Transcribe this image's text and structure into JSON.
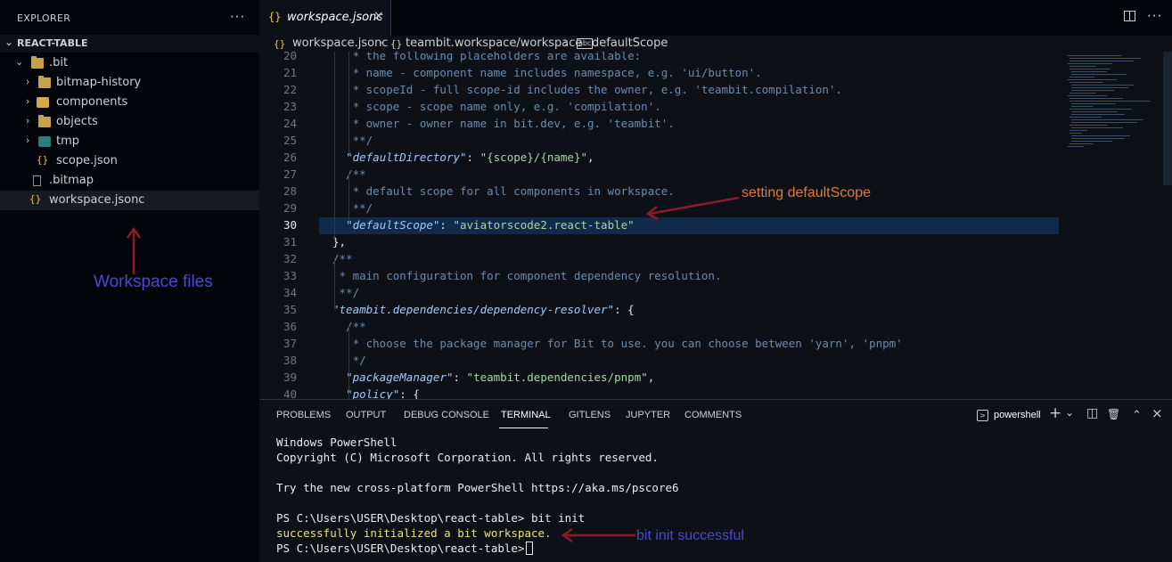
{
  "explorer": {
    "title": "EXPLORER",
    "more": "···",
    "section": "REACT-TABLE",
    "items": [
      {
        "label": ".bit",
        "chev": "⌄"
      },
      {
        "label": "bitmap-history",
        "chev": "›"
      },
      {
        "label": "components",
        "chev": "›"
      },
      {
        "label": "objects",
        "chev": "›"
      },
      {
        "label": "tmp",
        "chev": "›"
      },
      {
        "label": "scope.json",
        "icon": "{}"
      },
      {
        "label": ".bitmap"
      },
      {
        "label": "workspace.jsonc",
        "icon": "{}"
      }
    ]
  },
  "annotations": {
    "workspace_files": "Workspace files",
    "setting_scope": "setting defaultScope",
    "bit_init": "bit init successful",
    "colors": {
      "red_arrow": "#8b1a2b",
      "orange": "#e07b39",
      "blue": "#4a4ad0"
    }
  },
  "tab": {
    "icon": "{}",
    "label": "workspace.jsonc",
    "close": "×",
    "more": "···"
  },
  "breadcrumb": {
    "file_icon": "{}",
    "file": "workspace.jsonc",
    "sep": "›",
    "obj_icon": "{}",
    "obj": "teambit.workspace/workspace",
    "prop_icon": "abc",
    "prop": "defaultScope"
  },
  "editor": {
    "lines": [
      {
        "n": "20",
        "tokens": [
          {
            "t": "   * the following placeholders are available:",
            "c": "comment"
          }
        ]
      },
      {
        "n": "21",
        "tokens": [
          {
            "t": "   * name - component name includes namespace, e.g. 'ui/button'.",
            "c": "comment"
          }
        ]
      },
      {
        "n": "22",
        "tokens": [
          {
            "t": "   * scopeId - full scope-id includes the owner, e.g. 'teambit.compilation'.",
            "c": "comment"
          }
        ]
      },
      {
        "n": "23",
        "tokens": [
          {
            "t": "   * scope - scope name only, e.g. 'compilation'.",
            "c": "comment"
          }
        ]
      },
      {
        "n": "24",
        "tokens": [
          {
            "t": "   * owner - owner name in bit.dev, e.g. 'teambit'.",
            "c": "comment"
          }
        ]
      },
      {
        "n": "25",
        "tokens": [
          {
            "t": "   **/",
            "c": "comment"
          }
        ]
      },
      {
        "n": "26",
        "tokens": [
          {
            "t": "  ",
            "c": "punct"
          },
          {
            "t": "\"defaultDirectory\"",
            "c": "key"
          },
          {
            "t": ": ",
            "c": "punct"
          },
          {
            "t": "\"{scope}/{name}\"",
            "c": "str"
          },
          {
            "t": ",",
            "c": "punct"
          }
        ]
      },
      {
        "n": "27",
        "tokens": [
          {
            "t": "  /**",
            "c": "comment"
          }
        ]
      },
      {
        "n": "28",
        "tokens": [
          {
            "t": "   * default scope for all components in workspace.",
            "c": "comment"
          }
        ]
      },
      {
        "n": "29",
        "tokens": [
          {
            "t": "   **/",
            "c": "comment"
          }
        ]
      },
      {
        "n": "30",
        "tokens": [
          {
            "t": "  ",
            "c": "punct"
          },
          {
            "t": "\"defaultScope\"",
            "c": "key"
          },
          {
            "t": ": ",
            "c": "punct"
          },
          {
            "t": "\"aviatorscode2.react-table\"",
            "c": "str"
          }
        ]
      },
      {
        "n": "31",
        "tokens": [
          {
            "t": "},",
            "c": "punct"
          }
        ]
      },
      {
        "n": "32",
        "tokens": [
          {
            "t": "/**",
            "c": "comment"
          }
        ]
      },
      {
        "n": "33",
        "tokens": [
          {
            "t": " * main configuration for component dependency resolution.",
            "c": "comment"
          }
        ]
      },
      {
        "n": "34",
        "tokens": [
          {
            "t": " **/",
            "c": "comment"
          }
        ]
      },
      {
        "n": "35",
        "tokens": [
          {
            "t": "\"teambit.dependencies/dependency-resolver\"",
            "c": "key"
          },
          {
            "t": ": {",
            "c": "punct"
          }
        ]
      },
      {
        "n": "36",
        "tokens": [
          {
            "t": "  /**",
            "c": "comment"
          }
        ]
      },
      {
        "n": "37",
        "tokens": [
          {
            "t": "   * choose the package manager for Bit to use. you can choose between 'yarn', 'pnpm'",
            "c": "comment"
          }
        ]
      },
      {
        "n": "38",
        "tokens": [
          {
            "t": "   */",
            "c": "comment"
          }
        ]
      },
      {
        "n": "39",
        "tokens": [
          {
            "t": "  ",
            "c": "punct"
          },
          {
            "t": "\"packageManager\"",
            "c": "key"
          },
          {
            "t": ": ",
            "c": "punct"
          },
          {
            "t": "\"teambit.dependencies/pnpm\"",
            "c": "str"
          },
          {
            "t": ",",
            "c": "punct"
          }
        ]
      },
      {
        "n": "40",
        "tokens": [
          {
            "t": "  ",
            "c": "punct"
          },
          {
            "t": "\"policy\"",
            "c": "key"
          },
          {
            "t": ": {",
            "c": "punct"
          }
        ]
      }
    ],
    "current_line": "30"
  },
  "panel": {
    "tabs": [
      "PROBLEMS",
      "OUTPUT",
      "DEBUG CONSOLE",
      "TERMINAL",
      "GITLENS",
      "JUPYTER",
      "COMMENTS"
    ],
    "active_tab": "TERMINAL",
    "shell": "powershell",
    "shell_icon": ">",
    "buttons": {
      "add": "+",
      "dropdown": "⌄",
      "split": "◫",
      "trash": "🗑",
      "maximize": "⌃",
      "close": "×"
    }
  },
  "terminal": {
    "lines": [
      "Windows PowerShell",
      "Copyright (C) Microsoft Corporation. All rights reserved.",
      "",
      "Try the new cross-platform PowerShell https://aka.ms/pscore6",
      "",
      "PS C:\\Users\\USER\\Desktop\\react-table> bit init",
      "successfully initialized a bit workspace.",
      "PS C:\\Users\\USER\\Desktop\\react-table>"
    ]
  }
}
